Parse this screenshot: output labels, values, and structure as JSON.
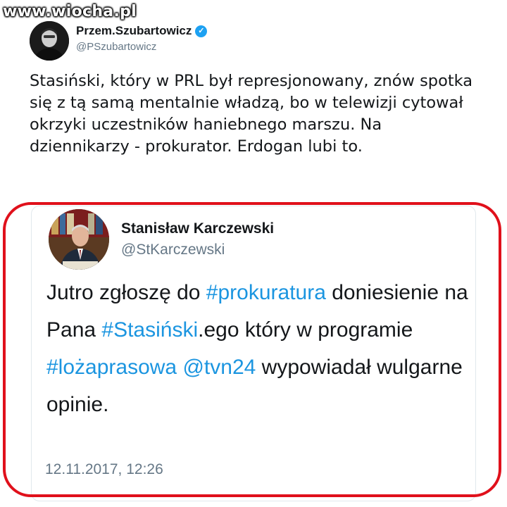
{
  "watermark": {
    "text": "www.wiocha.pl"
  },
  "outer_tweet": {
    "name": "Przem.Szubartowicz",
    "handle": "@PSzubartowicz",
    "verified_icon": "check-icon",
    "text": "Stasiński, który w PRL był represjonowany, znów spotka się z tą samą mentalnie władzą, bo w telewizji cytował okrzyki uczestników haniebnego marszu. Na dziennikarzy - prokurator. Erdogan lubi to."
  },
  "quoted_tweet": {
    "name": "Stanisław Karczewski",
    "handle": "@StKarczewski",
    "text_parts": {
      "p1": "Jutro zgłoszę do ",
      "tag1": "#prokuratura",
      "p2": " doniesienie na Pana ",
      "tag2": "#Stasiński",
      "p3": ".ego który w programie ",
      "tag3": "#lożaprasowa",
      "p4": " ",
      "mention": "@tvn24",
      "p5": " wypowiadał wulgarne opinie."
    },
    "timestamp": "12.11.2017, 12:26"
  },
  "colors": {
    "link": "#1b95e0",
    "highlight_ring": "#e0101b",
    "muted_text": "#657786",
    "verified": "#1da1f2"
  }
}
